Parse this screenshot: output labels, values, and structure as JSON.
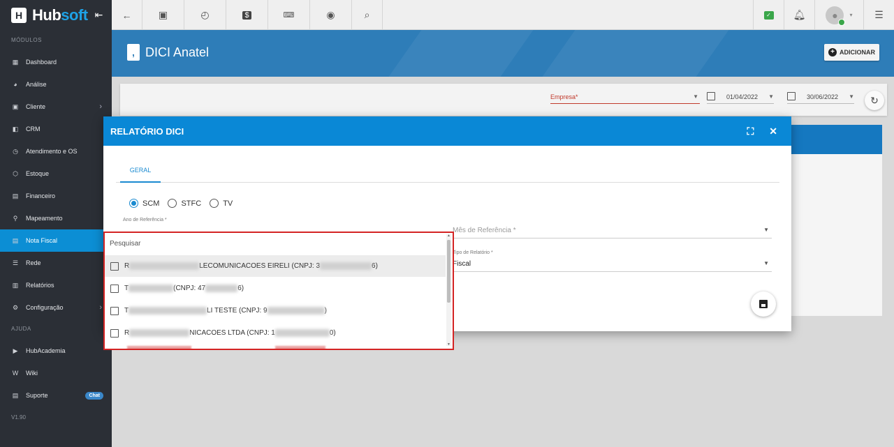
{
  "app": {
    "brand_a": "Hub",
    "brand_b": "soft",
    "collapse_icon": "menu-collapse-icon"
  },
  "sidebar": {
    "section_modules": "MÓDULOS",
    "items": [
      {
        "label": "Dashboard",
        "icon": "dashboard-icon"
      },
      {
        "label": "Análise",
        "icon": "pie-chart-icon"
      },
      {
        "label": "Cliente",
        "icon": "contact-card-icon",
        "chevron": true
      },
      {
        "label": "CRM",
        "icon": "crm-icon"
      },
      {
        "label": "Atendimento e OS",
        "icon": "clock-icon"
      },
      {
        "label": "Estoque",
        "icon": "box-icon"
      },
      {
        "label": "Financeiro",
        "icon": "money-icon"
      },
      {
        "label": "Mapeamento",
        "icon": "map-pin-icon"
      },
      {
        "label": "Nota Fiscal",
        "icon": "invoice-icon",
        "active": true
      },
      {
        "label": "Rede",
        "icon": "network-icon"
      },
      {
        "label": "Relatórios",
        "icon": "report-icon"
      },
      {
        "label": "Configuração",
        "icon": "gear-icon",
        "chevron": true
      }
    ],
    "section_help": "AJUDA",
    "help_items": [
      {
        "label": "HubAcademia",
        "icon": "youtube-icon"
      },
      {
        "label": "Wiki",
        "icon": "wiki-icon"
      },
      {
        "label": "Suporte",
        "icon": "support-icon",
        "badge": "Chat"
      }
    ],
    "version": "V1.90"
  },
  "page": {
    "title": "DICI Anatel",
    "add_label": "ADICIONAR"
  },
  "filter": {
    "empresa_placeholder": "Empresa*",
    "date_from": "01/04/2022",
    "date_to": "30/06/2022"
  },
  "modal": {
    "title": "RELATÓRIO DICI",
    "tab": "GERAL",
    "radios": [
      "SCM",
      "STFC",
      "TV"
    ],
    "selected_radio": "SCM",
    "ano_label": "Ano de Referência *",
    "mes_label": "Mês de Referência *",
    "tipo_label": "Tipo de Relatório *",
    "tipo_value": "Fiscal"
  },
  "dropdown": {
    "search_placeholder": "Pesquisar",
    "options": [
      {
        "prefix": "R",
        "text": "LECOMUNICACOES EIRELI (CNPJ: 3",
        "suffix": "6)"
      },
      {
        "prefix": "T",
        "text": " (CNPJ: 47",
        "suffix": "6)"
      },
      {
        "prefix": "T",
        "text": "LI TESTE (CNPJ: 9",
        "suffix": ")"
      },
      {
        "prefix": "R",
        "text": "NICACOES LTDA (CNPJ: 1",
        "suffix": "0)"
      }
    ]
  },
  "colors": {
    "sidebar": "#2b2f36",
    "active": "#0c8ed4",
    "band": "#2e7db8",
    "modal_head": "#0a88d6",
    "dropdown_border": "#d42323"
  }
}
